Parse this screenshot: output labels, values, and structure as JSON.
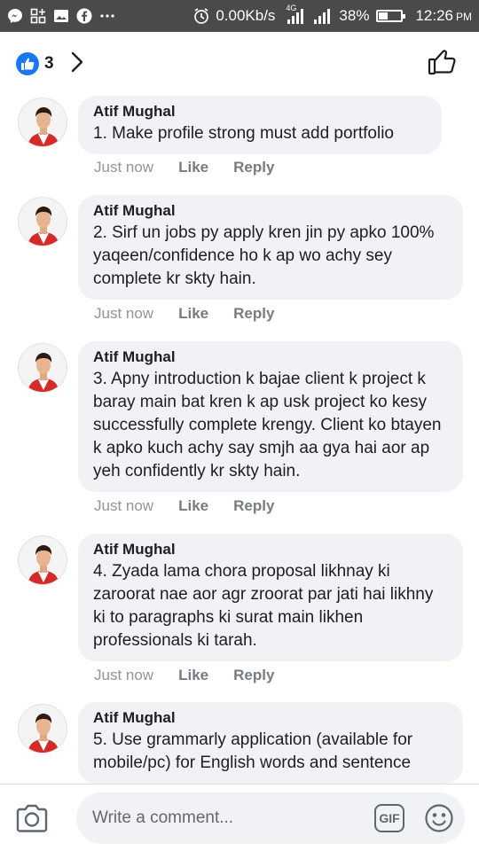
{
  "status_bar": {
    "network_speed": "0.00Kb/s",
    "network_type": "4G",
    "battery": "38%",
    "battery_level": 0.38,
    "time": "12:26",
    "time_suffix": "PM",
    "icons": [
      "messenger-icon",
      "apps-grid-icon",
      "gallery-icon",
      "facebook-icon",
      "more-dots-icon",
      "alarm-icon",
      "signal-1-icon",
      "signal-2-icon",
      "battery-icon"
    ]
  },
  "header": {
    "like_count": "3",
    "icons": [
      "like-reaction-icon",
      "chevron-right-icon",
      "thumbs-up-icon"
    ]
  },
  "colors": {
    "facebook_blue": "#1877f2",
    "bubble_bg": "#f0f2f5",
    "status_bar_bg": "#4a4a4a"
  },
  "comments": [
    {
      "author": "Atif Mughal",
      "text": "1. Make profile strong must add portfolio",
      "time": "Just now",
      "like_label": "Like",
      "reply_label": "Reply"
    },
    {
      "author": "Atif Mughal",
      "text": "2. Sirf un jobs py apply kren jin py apko 100% yaqeen/confidence ho k ap wo achy sey complete kr skty hain.",
      "time": "Just now",
      "like_label": "Like",
      "reply_label": "Reply"
    },
    {
      "author": "Atif Mughal",
      "text": "3. Apny introduction k bajae client k project k baray main bat kren k ap usk project ko kesy successfully complete krengy. Client ko btayen k apko kuch achy say smjh aa gya hai aor ap yeh confidently kr skty hain.",
      "time": "Just now",
      "like_label": "Like",
      "reply_label": "Reply"
    },
    {
      "author": "Atif Mughal",
      "text": "4. Zyada lama chora proposal likhnay ki zaroorat nae aor agr zroorat par jati hai likhny ki to paragraphs ki surat main likhen professionals ki tarah.",
      "time": "Just now",
      "like_label": "Like",
      "reply_label": "Reply"
    },
    {
      "author": "Atif Mughal",
      "text": "5. Use grammarly application (available for mobile/pc) for English words and sentence",
      "time": "",
      "like_label": "",
      "reply_label": ""
    }
  ],
  "composer": {
    "placeholder": "Write a comment...",
    "gif_label": "GIF",
    "icons": [
      "camera-icon",
      "gif-icon",
      "emoji-icon"
    ]
  }
}
